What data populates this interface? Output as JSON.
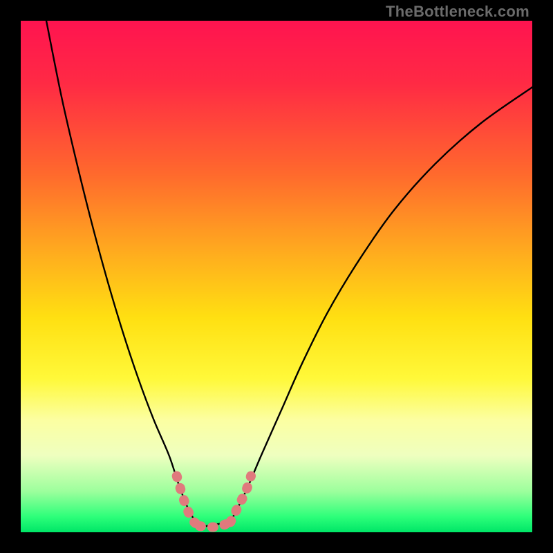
{
  "watermark": "TheBottleneck.com",
  "chart_data": {
    "type": "line",
    "title": "",
    "xlabel": "",
    "ylabel": "",
    "xlim": [
      0,
      100
    ],
    "ylim": [
      0,
      100
    ],
    "grid": false,
    "legend": false,
    "series": [
      {
        "name": "left-curve",
        "x": [
          5,
          8,
          11,
          14,
          17,
          20,
          23,
          26,
          29,
          31,
          33,
          35
        ],
        "y": [
          100,
          85,
          72,
          60,
          49,
          39,
          30,
          22,
          15,
          9,
          4,
          1
        ]
      },
      {
        "name": "right-curve",
        "x": [
          41,
          44,
          47,
          51,
          55,
          60,
          66,
          73,
          81,
          90,
          100
        ],
        "y": [
          2,
          8,
          15,
          24,
          33,
          43,
          53,
          63,
          72,
          80,
          87
        ]
      },
      {
        "name": "flat-bottom",
        "x": [
          35,
          41
        ],
        "y": [
          1,
          2
        ]
      }
    ],
    "highlight_segments": [
      {
        "name": "left-foot",
        "x": [
          30.5,
          32,
          33.5,
          35
        ],
        "y": [
          11,
          6,
          2.5,
          1.2
        ]
      },
      {
        "name": "bottom",
        "x": [
          35,
          37,
          39,
          41
        ],
        "y": [
          1.2,
          1.0,
          1.2,
          2
        ]
      },
      {
        "name": "right-foot",
        "x": [
          41,
          42.5,
          44,
          45
        ],
        "y": [
          2,
          5,
          8,
          11
        ]
      }
    ],
    "gradient_stops": [
      {
        "pct": 0,
        "color": "#ff1450"
      },
      {
        "pct": 12,
        "color": "#ff2a45"
      },
      {
        "pct": 30,
        "color": "#ff6a2d"
      },
      {
        "pct": 45,
        "color": "#ffab1f"
      },
      {
        "pct": 58,
        "color": "#ffe012"
      },
      {
        "pct": 70,
        "color": "#fff93a"
      },
      {
        "pct": 78,
        "color": "#fcffa2"
      },
      {
        "pct": 85,
        "color": "#efffc0"
      },
      {
        "pct": 92,
        "color": "#9dff9d"
      },
      {
        "pct": 97,
        "color": "#2dff7a"
      },
      {
        "pct": 100,
        "color": "#00e667"
      }
    ],
    "curve_color": "#000000",
    "highlight_color": "#e07a7d"
  }
}
